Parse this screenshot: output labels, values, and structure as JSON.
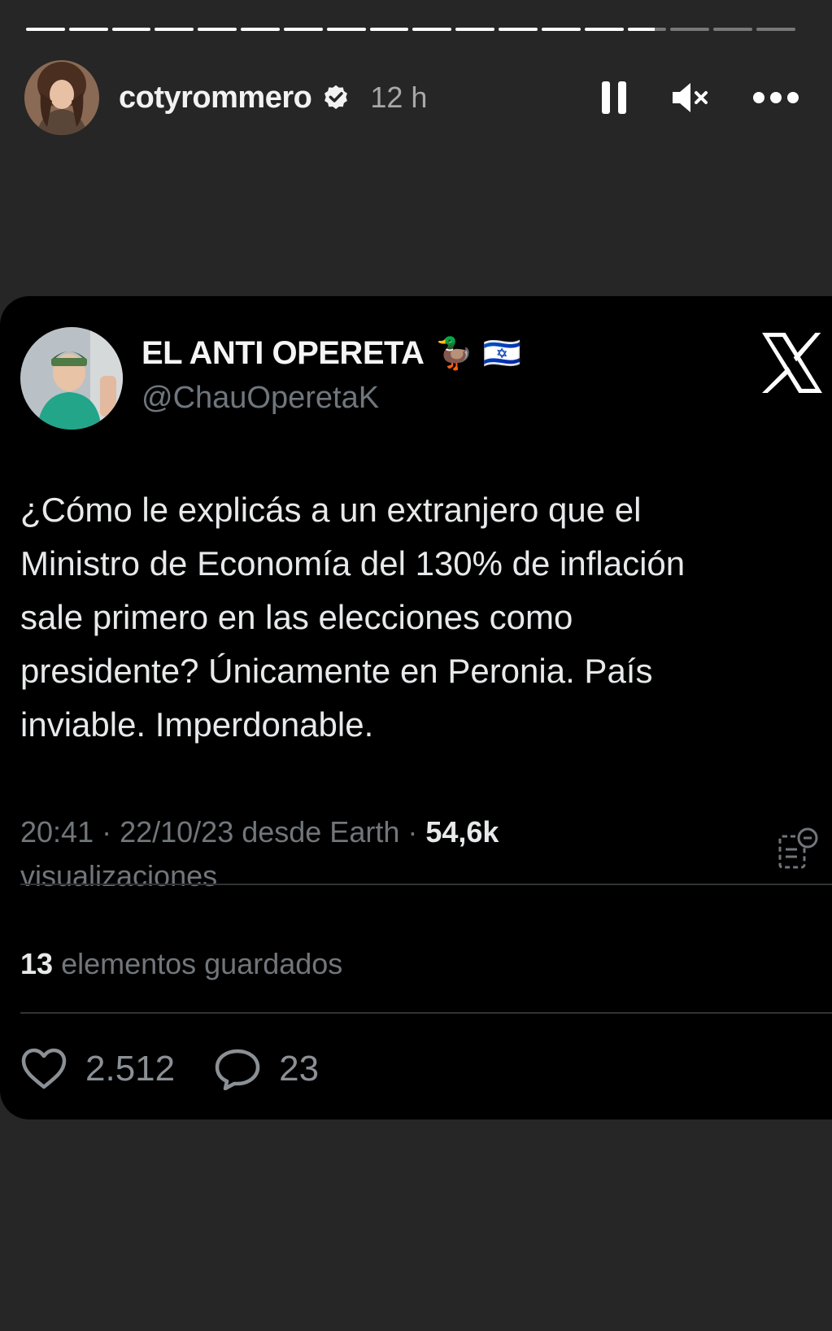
{
  "story": {
    "progress_segments": [
      1,
      1,
      1,
      1,
      1,
      1,
      1,
      1,
      1,
      1,
      1,
      1,
      1,
      1,
      0.7,
      0,
      0,
      0
    ],
    "username": "cotyrommero",
    "time": "12 h",
    "icons": {
      "verified": "verified-badge-icon",
      "pause": "pause-icon",
      "mute": "mute-icon",
      "more": "more-icon"
    }
  },
  "tweet": {
    "display_name": "EL ANTI OPERETA",
    "name_emojis": "🦆 🇮🇱",
    "handle": "@ChauOperetaK",
    "lines": [
      "¿Cómo le explicás a un extranjero que el",
      "Ministro de Economía del 130% de inflación",
      "sale primero en las elecciones como",
      "presidente? Únicamente en Peronia. País",
      "inviable. Imperdonable."
    ],
    "timestamp": "20:41 · 22/10/23 desde Earth ·",
    "views_count": "54,6k",
    "views_label": "visualizaciones",
    "saved_count": "13",
    "saved_label": "elementos guardados",
    "likes": "2.512",
    "replies": "23",
    "icons": {
      "platform": "x-logo-icon",
      "notes": "notes-icon",
      "like": "heart-icon",
      "reply": "reply-icon"
    }
  },
  "colors": {
    "background": "#262626",
    "card": "#000000",
    "muted_text": "#71767b"
  }
}
